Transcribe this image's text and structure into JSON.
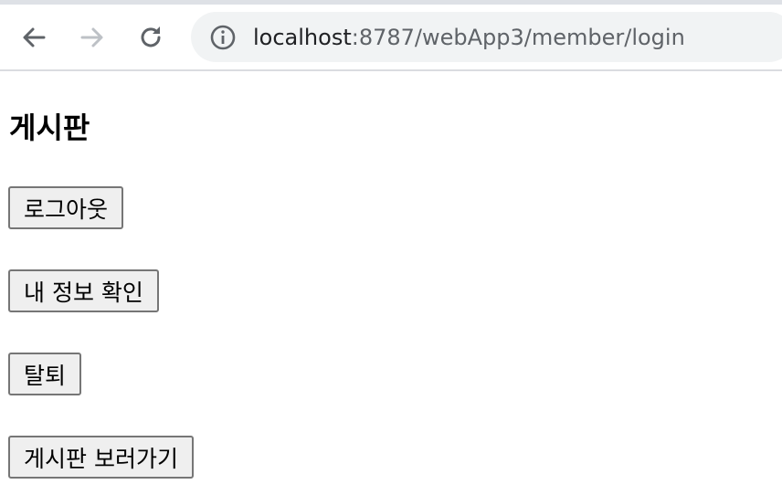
{
  "browser": {
    "url_host": "localhost",
    "url_rest": ":8787/webApp3/member/login",
    "icons": {
      "back": "back-arrow-icon",
      "forward": "forward-arrow-icon",
      "reload": "reload-icon",
      "info": "info-icon"
    }
  },
  "page": {
    "heading": "게시판",
    "buttons": {
      "logout": "로그아웃",
      "my_info": "내 정보 확인",
      "withdraw": "탈퇴",
      "view_board": "게시판 보러가기"
    }
  }
}
